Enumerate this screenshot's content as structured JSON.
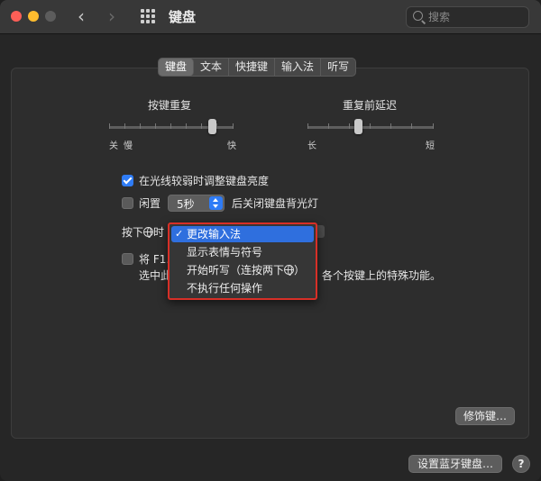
{
  "window": {
    "title": "键盘",
    "nav_back": "‹",
    "nav_forward": "›",
    "search": {
      "placeholder": "搜索",
      "value": ""
    }
  },
  "tabs": [
    {
      "label": "键盘",
      "selected": true
    },
    {
      "label": "文本",
      "selected": false
    },
    {
      "label": "快捷键",
      "selected": false
    },
    {
      "label": "输入法",
      "selected": false
    },
    {
      "label": "听写",
      "selected": false
    }
  ],
  "key_repeat": {
    "title": "按键重复",
    "min_label": "关",
    "min_label2": "慢",
    "max_label": "快"
  },
  "repeat_delay": {
    "title": "重复前延迟",
    "min_label": "长",
    "max_label": "短"
  },
  "options": {
    "adjust_brightness": {
      "label": "在光线较弱时调整键盘亮度",
      "checked": true
    },
    "idle_backlight": {
      "prefix": "闲置",
      "value": "5秒",
      "suffix": "后关闭键盘背光灯",
      "checked": false
    },
    "globe_key": {
      "prefix": "按下",
      "suffix": "时"
    },
    "fn_keys": {
      "label": "将 F1…",
      "description_prefix": "选中此",
      "description_suffix": "各个按键上的特殊功能。",
      "checked": false
    }
  },
  "dropdown_menu": {
    "items": [
      {
        "label": "更改输入法",
        "selected": true
      },
      {
        "label": "显示表情与符号",
        "selected": false
      },
      {
        "label": "开始听写（连按两下",
        "suffix": "）",
        "selected": false
      },
      {
        "label": "不执行任何操作",
        "selected": false
      }
    ],
    "check": "✓"
  },
  "buttons": {
    "modifier_keys": "修饰键…",
    "bluetooth_keyboard": "设置蓝牙键盘…",
    "help": "?"
  },
  "colors": {
    "accent": "#2f7cf6",
    "highlight_box": "#d72f27",
    "menu_selection": "#2f6fde"
  }
}
